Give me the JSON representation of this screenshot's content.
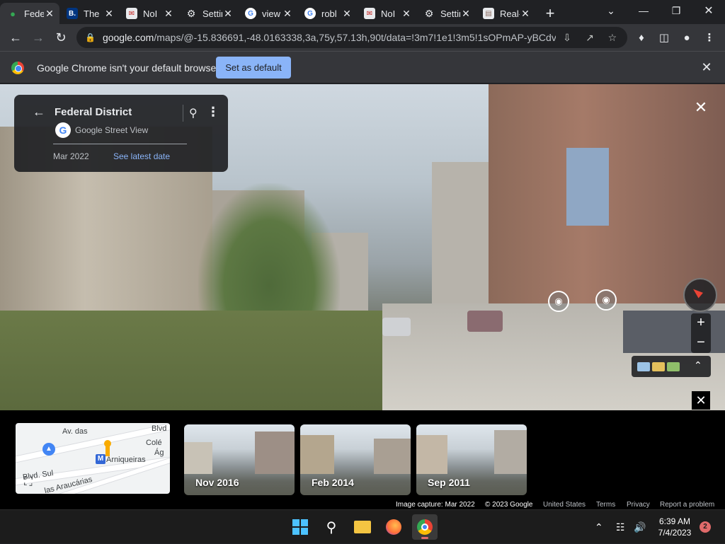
{
  "browser": {
    "tabs": [
      {
        "title": "Federal District",
        "icon": "maps-pin-icon",
        "active": true
      },
      {
        "title": "The",
        "icon": "booking-icon"
      },
      {
        "title": "NoI",
        "icon": "mail-icon"
      },
      {
        "title": "Settings",
        "icon": "gear-icon"
      },
      {
        "title": "view",
        "icon": "google-icon"
      },
      {
        "title": "robl",
        "icon": "google-icon"
      },
      {
        "title": "NoI",
        "icon": "mail-icon"
      },
      {
        "title": "Settings",
        "icon": "gear-icon"
      },
      {
        "title": "Real-time",
        "icon": "page-icon"
      }
    ],
    "address": {
      "domain": "google.com",
      "path": "/maps/@-15.836691,-48.0163338,3a,75y,57.13h,90t/data=!3m7!1e1!3m5!1sOPmAP-yBCdv..."
    }
  },
  "infobar": {
    "message": "Google Chrome isn't your default browser",
    "button": "Set as default"
  },
  "streetview": {
    "place_title": "Federal District",
    "source": "Google Street View",
    "capture_date": "Mar 2022",
    "latest_link": "See latest date"
  },
  "minimap": {
    "labels": [
      "Av. das",
      "Blvd",
      "Colé",
      "Ág",
      "Arniqueiras",
      "Blvd. Sul",
      "las Araucárias"
    ],
    "metro_letter": "M"
  },
  "timeline": [
    {
      "label": "Nov 2016"
    },
    {
      "label": "Feb 2014"
    },
    {
      "label": "Sep 2011"
    }
  ],
  "attribution": {
    "capture": "Image capture: Mar 2022",
    "copyright": "© 2023 Google",
    "country": "United States",
    "terms": "Terms",
    "privacy": "Privacy",
    "report": "Report a problem"
  },
  "taskbar": {
    "time": "6:39 AM",
    "date": "7/4/2023",
    "notifications": "2"
  },
  "colors": {
    "accent": "#8ab4f8",
    "chrome_dark": "#202124",
    "toolbar": "#35363a"
  }
}
